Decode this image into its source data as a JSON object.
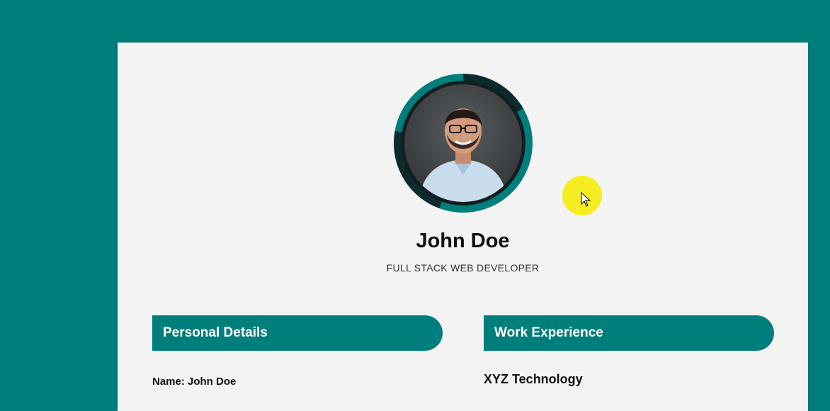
{
  "profile": {
    "name": "John Doe",
    "title": "FULL STACK WEB DEVELOPER"
  },
  "sections": {
    "personal": {
      "header": "Personal Details",
      "fields": [
        {
          "text": "Name: John Doe"
        }
      ]
    },
    "work": {
      "header": "Work Experience",
      "company": "XYZ Technology"
    }
  },
  "colors": {
    "accent": "#007e7c",
    "page": "#f3f3f3",
    "highlight": "#f5ec22"
  }
}
